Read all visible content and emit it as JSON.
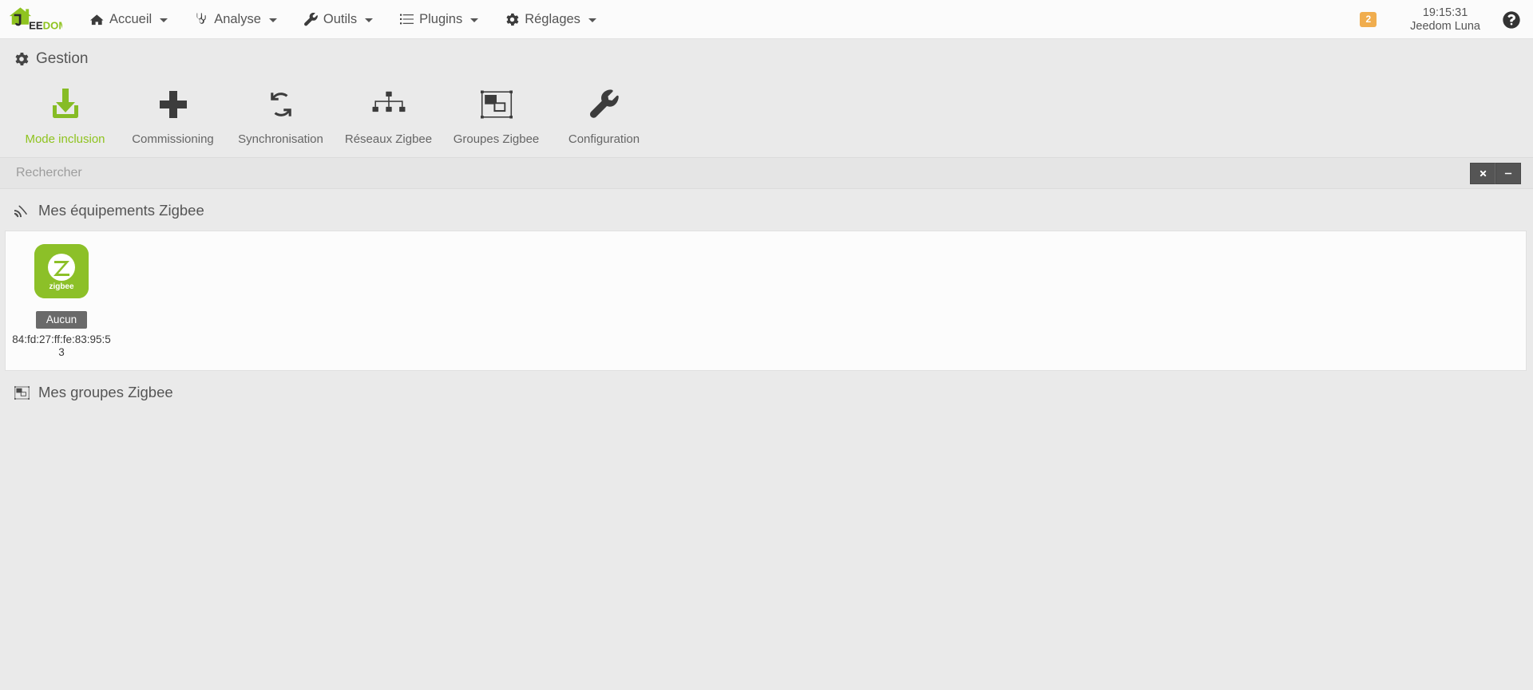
{
  "navbar": {
    "brand": "JEEDOM",
    "menu": [
      {
        "label": "Accueil",
        "icon": "home-icon"
      },
      {
        "label": "Analyse",
        "icon": "stethoscope-icon"
      },
      {
        "label": "Outils",
        "icon": "wrench-icon"
      },
      {
        "label": "Plugins",
        "icon": "list-icon"
      },
      {
        "label": "Réglages",
        "icon": "gear-icon"
      }
    ],
    "message_count": "2",
    "time": "19:15:31",
    "user": "Jeedom Luna",
    "help_icon": "question-circle-icon"
  },
  "gestion": {
    "title": "Gestion",
    "title_icon": "gear-icon",
    "tools": [
      {
        "label": "Mode inclusion",
        "icon": "download-arrow-icon",
        "active": true
      },
      {
        "label": "Commissioning",
        "icon": "plus-icon",
        "active": false
      },
      {
        "label": "Synchronisation",
        "icon": "refresh-icon",
        "active": false
      },
      {
        "label": "Réseaux Zigbee",
        "icon": "sitemap-icon",
        "active": false
      },
      {
        "label": "Groupes Zigbee",
        "icon": "object-group-icon",
        "active": false
      },
      {
        "label": "Configuration",
        "icon": "wrench-icon",
        "active": false
      }
    ]
  },
  "search": {
    "placeholder": "Rechercher",
    "value": "",
    "clear_icon": "times-icon",
    "collapse_icon": "minus-icon"
  },
  "sections": {
    "equipments": {
      "title": "Mes équipements Zigbee",
      "icon": "signal-broadcast-icon",
      "items": [
        {
          "image_alt": "zigbee-logo",
          "image_text": "zigbee",
          "status": "Aucun",
          "name": "84:fd:27:ff:fe:83:95:53"
        }
      ]
    },
    "groups": {
      "title": "Mes groupes Zigbee",
      "icon": "object-group-icon",
      "items": []
    }
  },
  "colors": {
    "accent_green": "#8fc31f",
    "zigbee_green": "#8cc028",
    "badge_orange": "#f0ad4e",
    "status_gray": "#6a6a6a",
    "page_bg": "#eaeaea"
  }
}
